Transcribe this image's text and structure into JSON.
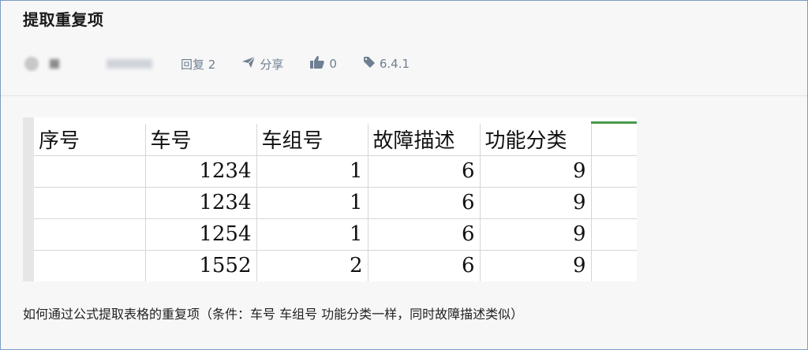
{
  "post": {
    "title": "提取重复项",
    "meta": {
      "replies": "回复 2",
      "share": "分享",
      "likes": "0",
      "tag": "6.4.1"
    },
    "table": {
      "headers": [
        "序号",
        "车号",
        "车组号",
        "故障描述",
        "功能分类"
      ],
      "rows": [
        [
          "",
          "1234",
          "1",
          "6",
          "9"
        ],
        [
          "",
          "1234",
          "1",
          "6",
          "9"
        ],
        [
          "",
          "1254",
          "1",
          "6",
          "9"
        ],
        [
          "",
          "1552",
          "2",
          "6",
          "9"
        ]
      ]
    },
    "question": "如何通过公式提取表格的重复项（条件：车号 车组号 功能分类一样，同时故障描述类似）"
  },
  "icons": {
    "share": "paper-plane-icon",
    "like": "thumbs-up-icon",
    "tag": "tag-icon"
  },
  "colors": {
    "meta_text": "#6f7f92",
    "title": "#1a1a1a",
    "frame_border": "#7a9cc6"
  }
}
